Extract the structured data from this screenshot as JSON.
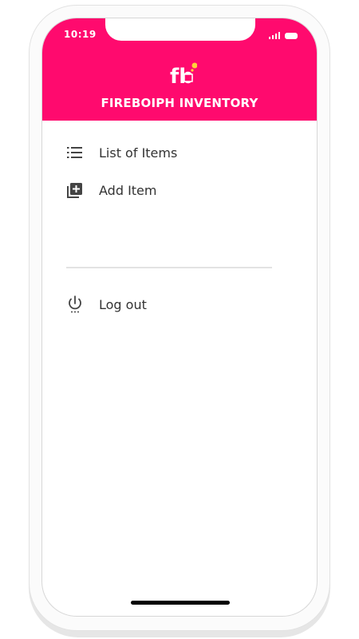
{
  "status_bar": {
    "time": "10:19"
  },
  "header": {
    "title": "FIREBOIPH INVENTORY",
    "logo_text": "fb",
    "background": "#ff0a6e"
  },
  "menu": {
    "items": [
      {
        "label": "List of Items",
        "icon": "list-icon"
      },
      {
        "label": "Add Item",
        "icon": "add-box-icon"
      }
    ],
    "logout": {
      "label": "Log out",
      "icon": "power-icon"
    }
  }
}
